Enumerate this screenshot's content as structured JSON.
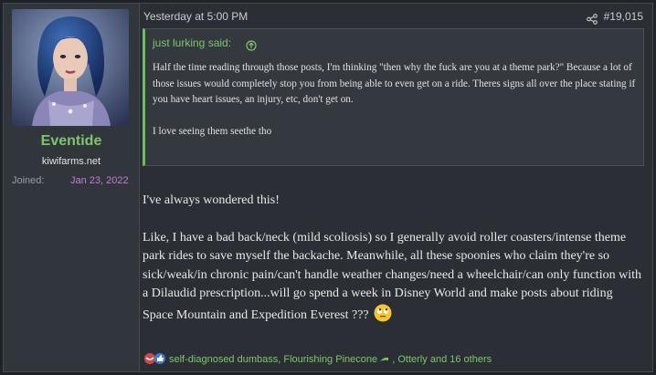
{
  "user": {
    "name": "Eventide",
    "title": "kiwifarms.net",
    "joined_label": "Joined:",
    "joined_value": "Jan 23, 2022"
  },
  "post": {
    "date": "Yesterday at 5:00 PM",
    "number": "#19,015",
    "quote": {
      "author": "just lurking said:",
      "paragraphs": [
        "Half the time reading through those posts, I'm thinking \"then why the fuck are you at a theme park?\" Because a lot of those issues would completely stop you from being able to even get on a ride. Theres signs all over the place stating if you have heart issues, an injury, etc, don't get on.",
        "I love seeing them seethe tho"
      ]
    },
    "body": [
      "I've always wondered this!",
      "Like, I have a bad back/neck (mild scoliosis) so I generally avoid roller coasters/intense theme park rides to save myself the backache. Meanwhile, all these spoonies who claim they're so sick/weak/in chronic pain/can't handle weather changes/need a wheelchair/can only function with a Dilaudid prescription...will go spend a week in Disney World and make posts about riding Space Mountain and Expedition Everest ???"
    ],
    "reactions": {
      "users": [
        "self-diagnosed dumbass",
        "Flourishing Pinecone",
        "Otterly"
      ],
      "others": "and 16 others"
    }
  },
  "colors": {
    "accent_green": "#7ec66b",
    "joined_purple": "#c77ad1",
    "background": "#2b2f35"
  },
  "icons": [
    "share-icon",
    "arrow-up-icon",
    "rolling-eyes-emoji",
    "reaction-icons"
  ]
}
